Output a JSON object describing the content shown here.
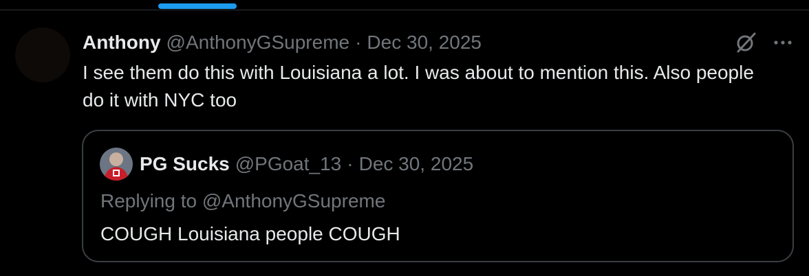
{
  "tweet": {
    "author_name": "Anthony",
    "author_handle": "@AnthonyGSupreme",
    "separator": "·",
    "date": "Dec 30, 2025",
    "text": "I see them do this with Louisiana a lot. I was about to mention this. Also people do it with NYC too",
    "icons": [
      "grok-icon",
      "more-icon"
    ]
  },
  "quote": {
    "author_name": "PG Sucks",
    "author_handle": "@PGoat_13",
    "separator": "·",
    "date": "Dec 30, 2025",
    "replying_to": "Replying to @AnthonyGSupreme",
    "text": "COUGH Louisiana people COUGH"
  },
  "colors": {
    "background": "#000000",
    "text_primary": "#e7e9ea",
    "text_secondary": "#71767b",
    "accent": "#1d9bf0",
    "border": "#3a3e42"
  }
}
